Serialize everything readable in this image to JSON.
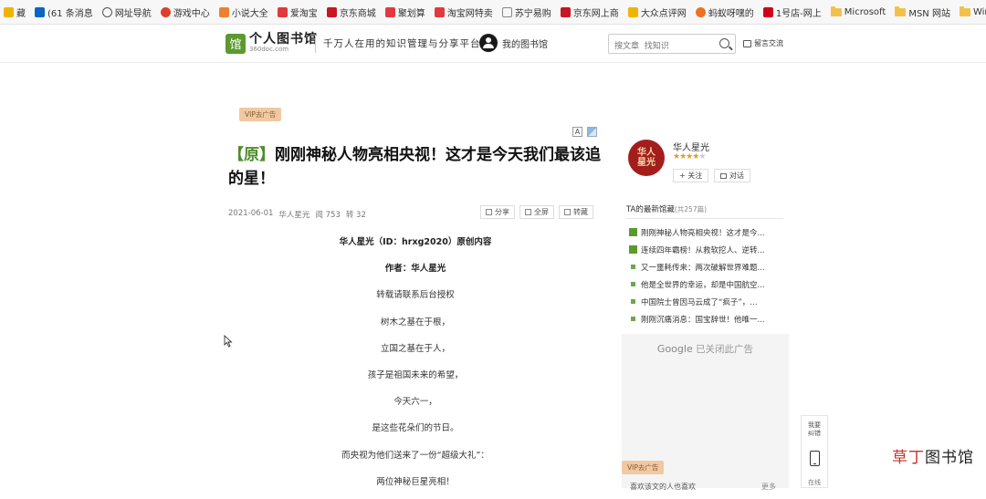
{
  "bookmarks": [
    {
      "label": "藏",
      "icon": "star-icon",
      "color": "#f0b400"
    },
    {
      "label": "(61 条消息",
      "icon": "zhihu-icon",
      "color": "#0a66c2"
    },
    {
      "label": "网址导航",
      "icon": "globe-icon",
      "color": "#555555"
    },
    {
      "label": "游戏中心",
      "icon": "game-icon",
      "color": "#e03e2d"
    },
    {
      "label": "小说大全",
      "icon": "book-icon",
      "color": "#f08030"
    },
    {
      "label": "爱淘宝",
      "icon": "taobao-icon",
      "color": "#e4393c"
    },
    {
      "label": "京东商城",
      "icon": "jd-icon",
      "color": "#c81623"
    },
    {
      "label": "聚划算",
      "icon": "taobao-icon",
      "color": "#e4393c"
    },
    {
      "label": "淘宝网特卖",
      "icon": "taobao-icon",
      "color": "#e4393c"
    },
    {
      "label": "苏宁易购",
      "icon": "page-icon",
      "color": "#888888"
    },
    {
      "label": "京东网上商",
      "icon": "jd-icon",
      "color": "#c81623"
    },
    {
      "label": "大众点评网",
      "icon": "dianping-icon",
      "color": "#f0b400"
    },
    {
      "label": "蚂蚁呀嘿的",
      "icon": "sogou-icon",
      "color": "#f07020"
    },
    {
      "label": "1号店-网上",
      "icon": "shop-icon",
      "color": "#d0021b"
    },
    {
      "label": "Microsoft",
      "icon": "folder-icon",
      "color": "#f2c14b"
    },
    {
      "label": "MSN 网站",
      "icon": "folder-icon",
      "color": "#f2c14b"
    },
    {
      "label": "Windov",
      "icon": "folder-icon",
      "color": "#f2c14b"
    }
  ],
  "header": {
    "logo_mark": "馆",
    "logo_title": "个人图书馆",
    "logo_sub": "360doc.com",
    "slogan": "千万人在用的知识管理与分享平台",
    "my_library": "我的图书馆",
    "search_placeholder": "搜文章  找知识",
    "message": "留言交流"
  },
  "article": {
    "vip_tag": "VIP去广告",
    "font_tool": "A",
    "title_tag": "【原】",
    "title": "刚刚神秘人物亮相央视！这才是今天我们最该追的星！",
    "date": "2021-06-01",
    "author": "华人星光",
    "reads": "阅 753",
    "reposts": "转 32",
    "actions": [
      "分享",
      "全屏",
      "转藏"
    ],
    "paragraphs": [
      {
        "text": "华人星光（ID：hrxg2020）原创内容",
        "bold": true
      },
      {
        "text": "作者：华人星光",
        "bold": true
      },
      {
        "text": "转载请联系后台授权",
        "bold": false
      },
      {
        "text": "树木之基在于根，",
        "bold": false
      },
      {
        "text": "立国之基在于人，",
        "bold": false
      },
      {
        "text": "孩子是祖国未来的希望，",
        "bold": false
      },
      {
        "text": "今天六一，",
        "bold": false
      },
      {
        "text": "是这些花朵们的节日。",
        "bold": false
      },
      {
        "text": "而央视为他们送来了一份“超级大礼”：",
        "bold": false
      },
      {
        "text": "两位神秘巨星亮相！",
        "bold": false
      }
    ]
  },
  "sidebar": {
    "avatar_text": "华人星光",
    "author_name": "华人星光",
    "rating_stars": 4,
    "rating_max": 5,
    "follow_label": "+ 关注",
    "chat_label": "对话",
    "latest_title": "TA的最新馆藏",
    "latest_count": "(共257篇)",
    "latest_items": [
      {
        "text": "刚刚神秘人物亮相央视！这才是今...",
        "original": true
      },
      {
        "text": "连续四年霸榜！从救软挖人、逆转...",
        "original": true
      },
      {
        "text": "又一噩耗传来：两次破解世界难题...",
        "original": false
      },
      {
        "text": "他是全世界的幸运，却是中国航空...",
        "original": false
      },
      {
        "text": "中国院士曾因马云成了“疯子”，...",
        "original": false
      },
      {
        "text": "刚刚沉痛消息：国宝辞世！他唯一...",
        "original": false
      }
    ],
    "ad_brand": "Google",
    "ad_text": "已关闭此广告",
    "vip_tag": "VIP去广告",
    "recommend_title": "喜欢该文的人也喜欢",
    "recommend_more": "更多"
  },
  "floatbar": {
    "top_text": "我要纠错",
    "bottom_text": "在线"
  },
  "watermark": {
    "red": "草丁",
    "black": "图书馆"
  }
}
